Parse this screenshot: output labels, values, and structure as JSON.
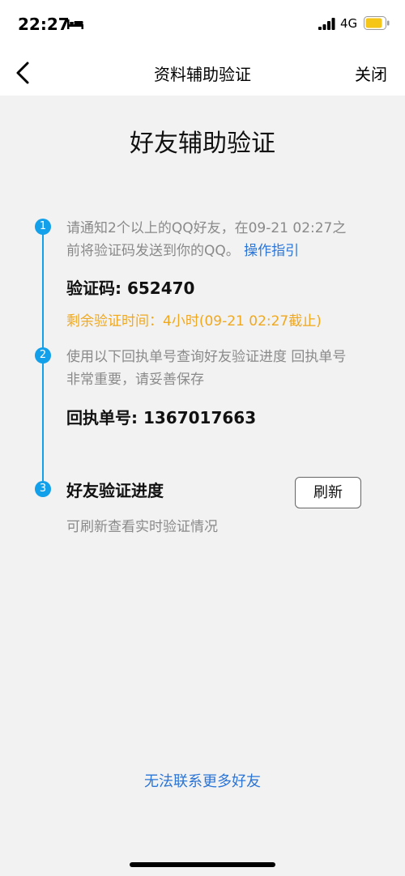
{
  "status_bar": {
    "time": "22:27",
    "network": "4G",
    "icons": [
      "bed-icon",
      "signal-icon",
      "battery-icon"
    ],
    "battery_color": "#f5c518"
  },
  "nav": {
    "title": "资料辅助验证",
    "close_label": "关闭",
    "back_icon": "chevron-left-icon"
  },
  "page": {
    "title": "好友辅助验证"
  },
  "steps": [
    {
      "number": "1",
      "text": "请通知2个以上的QQ好友，在09-21 02:27之前将验证码发送到你的QQ。",
      "link": "操作指引",
      "code_label": "验证码:",
      "code_value": "652470",
      "remaining": "剩余验证时间：4小时(09-21 02:27截止)"
    },
    {
      "number": "2",
      "text": "使用以下回执单号查询好友验证进度 回执单号非常重要，请妥善保存",
      "receipt_label": "回执单号:",
      "receipt_value": "1367017663"
    },
    {
      "number": "3",
      "title": "好友验证进度",
      "button_label": "刷新",
      "subtitle": "可刷新查看实时验证情况"
    }
  ],
  "footer": {
    "link": "无法联系更多好友"
  },
  "colors": {
    "accent": "#12a0ea",
    "link": "#2b75d6",
    "warning": "#f0a81f",
    "background": "#f2f2f2"
  }
}
